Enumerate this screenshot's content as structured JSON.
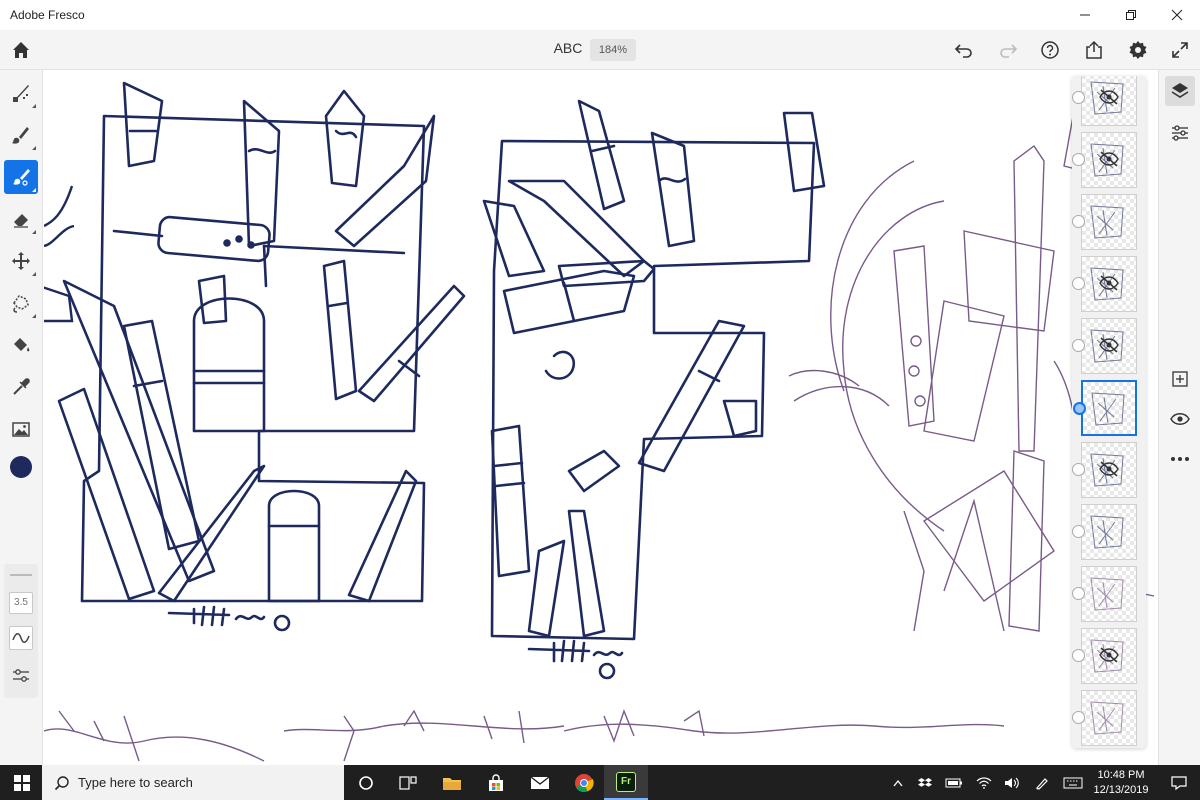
{
  "window": {
    "title": "Adobe Fresco"
  },
  "toolbar": {
    "doc_title": "ABC",
    "zoom": "184%"
  },
  "icons": {
    "home": "home-icon",
    "undo": "undo-icon",
    "redo": "redo-icon",
    "help": "help-icon",
    "share": "share-icon",
    "settings": "gear-icon",
    "fullscreen": "expand-icon"
  },
  "tools": [
    {
      "name": "pixel-brush",
      "active": false
    },
    {
      "name": "live-brush",
      "active": false
    },
    {
      "name": "vector-brush",
      "active": true
    },
    {
      "name": "eraser",
      "active": false
    },
    {
      "name": "move-transform",
      "active": false
    },
    {
      "name": "lasso-selection",
      "active": false
    },
    {
      "name": "fill",
      "active": false
    },
    {
      "name": "eyedropper",
      "active": false
    },
    {
      "name": "place-image",
      "active": false
    }
  ],
  "brush": {
    "color": "#1e2a5e",
    "size": "3.5"
  },
  "layers": {
    "count": 11,
    "selected_index": 5,
    "hidden": [
      0,
      1,
      3,
      4,
      6,
      9
    ]
  },
  "taskbar": {
    "search_placeholder": "Type here to search",
    "time": "10:48 PM",
    "date": "12/13/2019",
    "app_fresco_label": "Fr"
  },
  "colors": {
    "accent": "#1473e6",
    "ink": "#1e2a5e",
    "sketch": "#6b4a7e"
  }
}
